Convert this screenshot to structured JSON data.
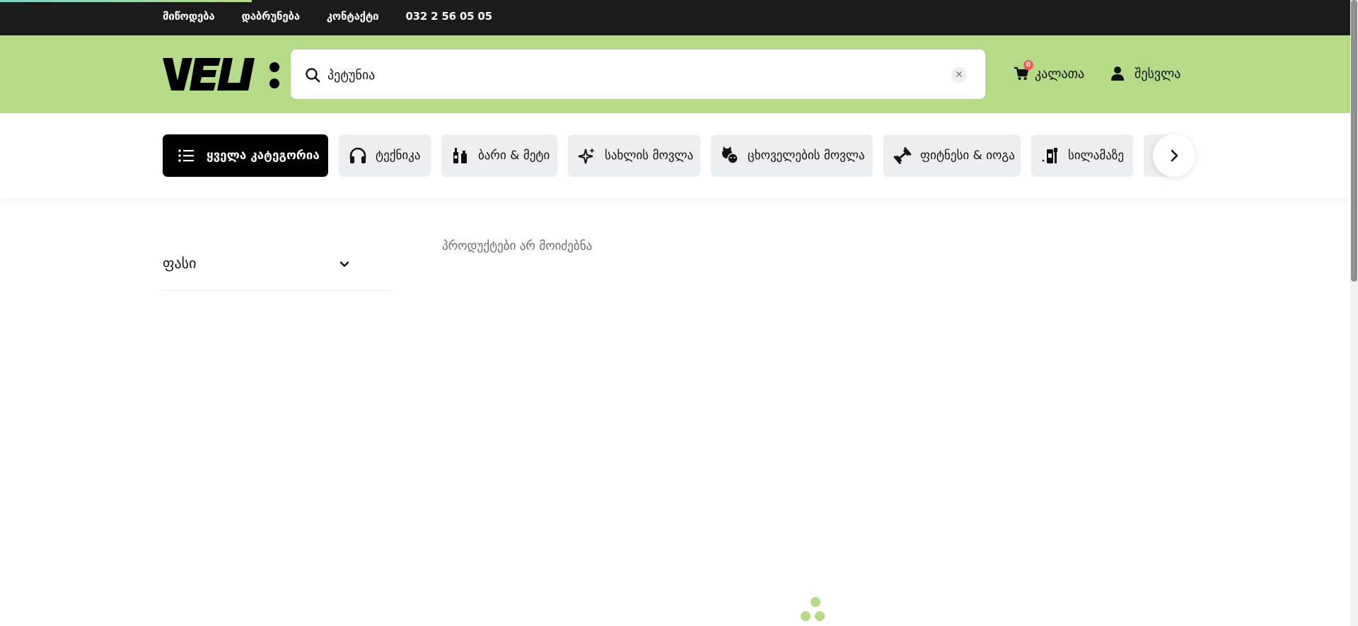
{
  "topbar": {
    "links": [
      "მიწოდება",
      "დაბრუნება",
      "კონტაქტი",
      "032 2 56 05 05"
    ]
  },
  "header": {
    "logo_text": "VELI:",
    "search": {
      "value": "პეტუნია",
      "placeholder": ""
    },
    "cart": {
      "label": "კალათა",
      "count": "0"
    },
    "login": {
      "label": "შესვლა"
    }
  },
  "categories": [
    {
      "label": "ყველა კატეგორია",
      "icon": "list-icon"
    },
    {
      "label": "ტექნიკა",
      "icon": "headphones-icon"
    },
    {
      "label": "ბარი & მეტი",
      "icon": "bottles-icon"
    },
    {
      "label": "სახლის მოვლა",
      "icon": "sparkle-icon"
    },
    {
      "label": "ცხოველების მოვლა",
      "icon": "pets-icon"
    },
    {
      "label": "ფიტნესი & იოგა",
      "icon": "dumbbell-icon"
    },
    {
      "label": "სილამაზე",
      "icon": "cosmetics-icon"
    }
  ],
  "filters": {
    "price_label": "ფასი"
  },
  "results": {
    "empty_message": "პროდუქტები არ მოიძებნა"
  },
  "colors": {
    "brand_green": "#b5da88",
    "topbar": "#1b1b1b",
    "badge": "#f2585f"
  }
}
